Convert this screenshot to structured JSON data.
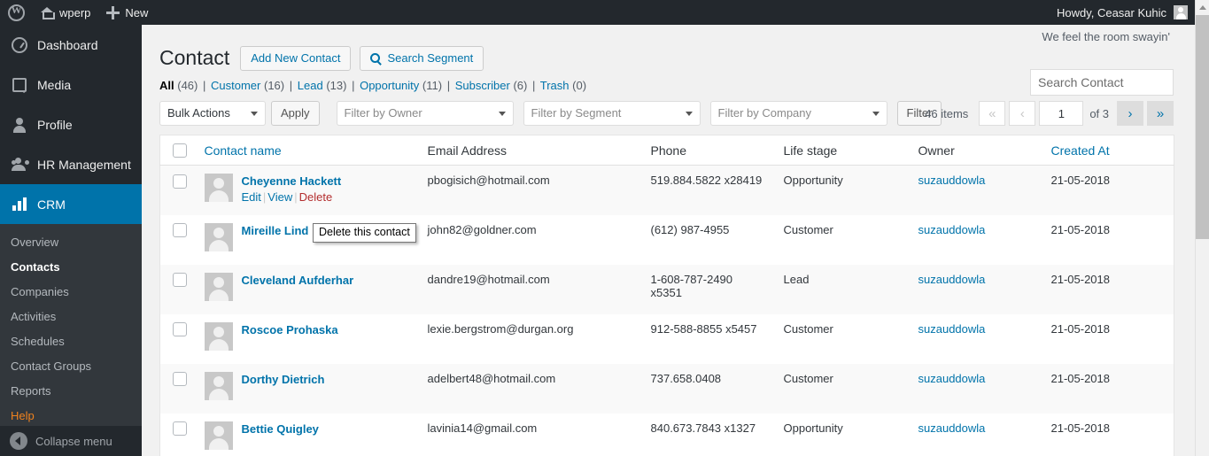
{
  "adminbar": {
    "wp_logo": "wordpress-logo",
    "site_name": "wperp",
    "new_label": "New",
    "howdy": "Howdy, Ceasar Kuhic"
  },
  "sidebar": {
    "top_items": [
      {
        "label": "Dashboard",
        "icon": "dashboard-icon",
        "current": false
      },
      {
        "label": "Media",
        "icon": "media-icon",
        "current": false
      },
      {
        "label": "Profile",
        "icon": "profile-icon",
        "current": false
      },
      {
        "label": "HR Management",
        "icon": "hr-management-icon",
        "current": false
      },
      {
        "label": "CRM",
        "icon": "crm-chart-icon",
        "current": true
      }
    ],
    "submenu": [
      {
        "label": "Overview",
        "current": false,
        "help": false
      },
      {
        "label": "Contacts",
        "current": true,
        "help": false
      },
      {
        "label": "Companies",
        "current": false,
        "help": false
      },
      {
        "label": "Activities",
        "current": false,
        "help": false
      },
      {
        "label": "Schedules",
        "current": false,
        "help": false
      },
      {
        "label": "Contact Groups",
        "current": false,
        "help": false
      },
      {
        "label": "Reports",
        "current": false,
        "help": false
      },
      {
        "label": "Help",
        "current": false,
        "help": true
      }
    ],
    "collapse_label": "Collapse menu"
  },
  "content": {
    "tagline": "We feel the room swayin'",
    "page_title": "Contact",
    "add_new_label": "Add New Contact",
    "search_segment_label": "Search Segment",
    "views": [
      {
        "label": "All",
        "count": "(46)",
        "current": true
      },
      {
        "label": "Customer",
        "count": "(16)",
        "current": false
      },
      {
        "label": "Lead",
        "count": "(13)",
        "current": false
      },
      {
        "label": "Opportunity",
        "count": "(11)",
        "current": false
      },
      {
        "label": "Subscriber",
        "count": "(6)",
        "current": false
      },
      {
        "label": "Trash",
        "count": "(0)",
        "current": false
      }
    ],
    "search_placeholder": "Search Contact"
  },
  "toolbar": {
    "bulk_actions_label": "Bulk Actions",
    "apply_label": "Apply",
    "filter_owner_label": "Filter by Owner",
    "filter_segment_label": "Filter by Segment",
    "filter_company_label": "Filter by Company",
    "filter_label": "Filter"
  },
  "pagination": {
    "items_text": "46 items",
    "first_label": "«",
    "prev_label": "‹",
    "current_page": "1",
    "of_total": "of 3",
    "next_label": "›",
    "last_label": "»"
  },
  "table": {
    "headers": {
      "name": "Contact name",
      "email": "Email Address",
      "phone": "Phone",
      "stage": "Life stage",
      "owner": "Owner",
      "created": "Created At"
    },
    "row_actions": {
      "edit": "Edit",
      "view": "View",
      "delete": "Delete"
    },
    "rows": [
      {
        "name": "Cheyenne Hackett",
        "email": "pbogisich@hotmail.com",
        "phone": "519.884.5822 x28419",
        "stage": "Opportunity",
        "owner": "suzauddowla",
        "created": "21-05-2018"
      },
      {
        "name": "Mireille Lind",
        "email": "john82@goldner.com",
        "phone": "(612) 987-4955",
        "stage": "Customer",
        "owner": "suzauddowla",
        "created": "21-05-2018"
      },
      {
        "name": "Cleveland Aufderhar",
        "email": "dandre19@hotmail.com",
        "phone": "1-608-787-2490 x5351",
        "stage": "Lead",
        "owner": "suzauddowla",
        "created": "21-05-2018"
      },
      {
        "name": "Roscoe Prohaska",
        "email": "lexie.bergstrom@durgan.org",
        "phone": "912-588-8855 x5457",
        "stage": "Customer",
        "owner": "suzauddowla",
        "created": "21-05-2018"
      },
      {
        "name": "Dorthy Dietrich",
        "email": "adelbert48@hotmail.com",
        "phone": "737.658.0408",
        "stage": "Customer",
        "owner": "suzauddowla",
        "created": "21-05-2018"
      },
      {
        "name": "Bettie Quigley",
        "email": "lavinia14@gmail.com",
        "phone": "840.673.7843 x1327",
        "stage": "Opportunity",
        "owner": "suzauddowla",
        "created": "21-05-2018"
      }
    ]
  },
  "tooltip": {
    "text": "Delete this contact"
  },
  "colors": {
    "admin_dark": "#23282d",
    "submenu_dark": "#32373c",
    "accent_blue": "#0073aa",
    "help_orange": "#f0821e",
    "delete_red": "#b32d2e"
  }
}
